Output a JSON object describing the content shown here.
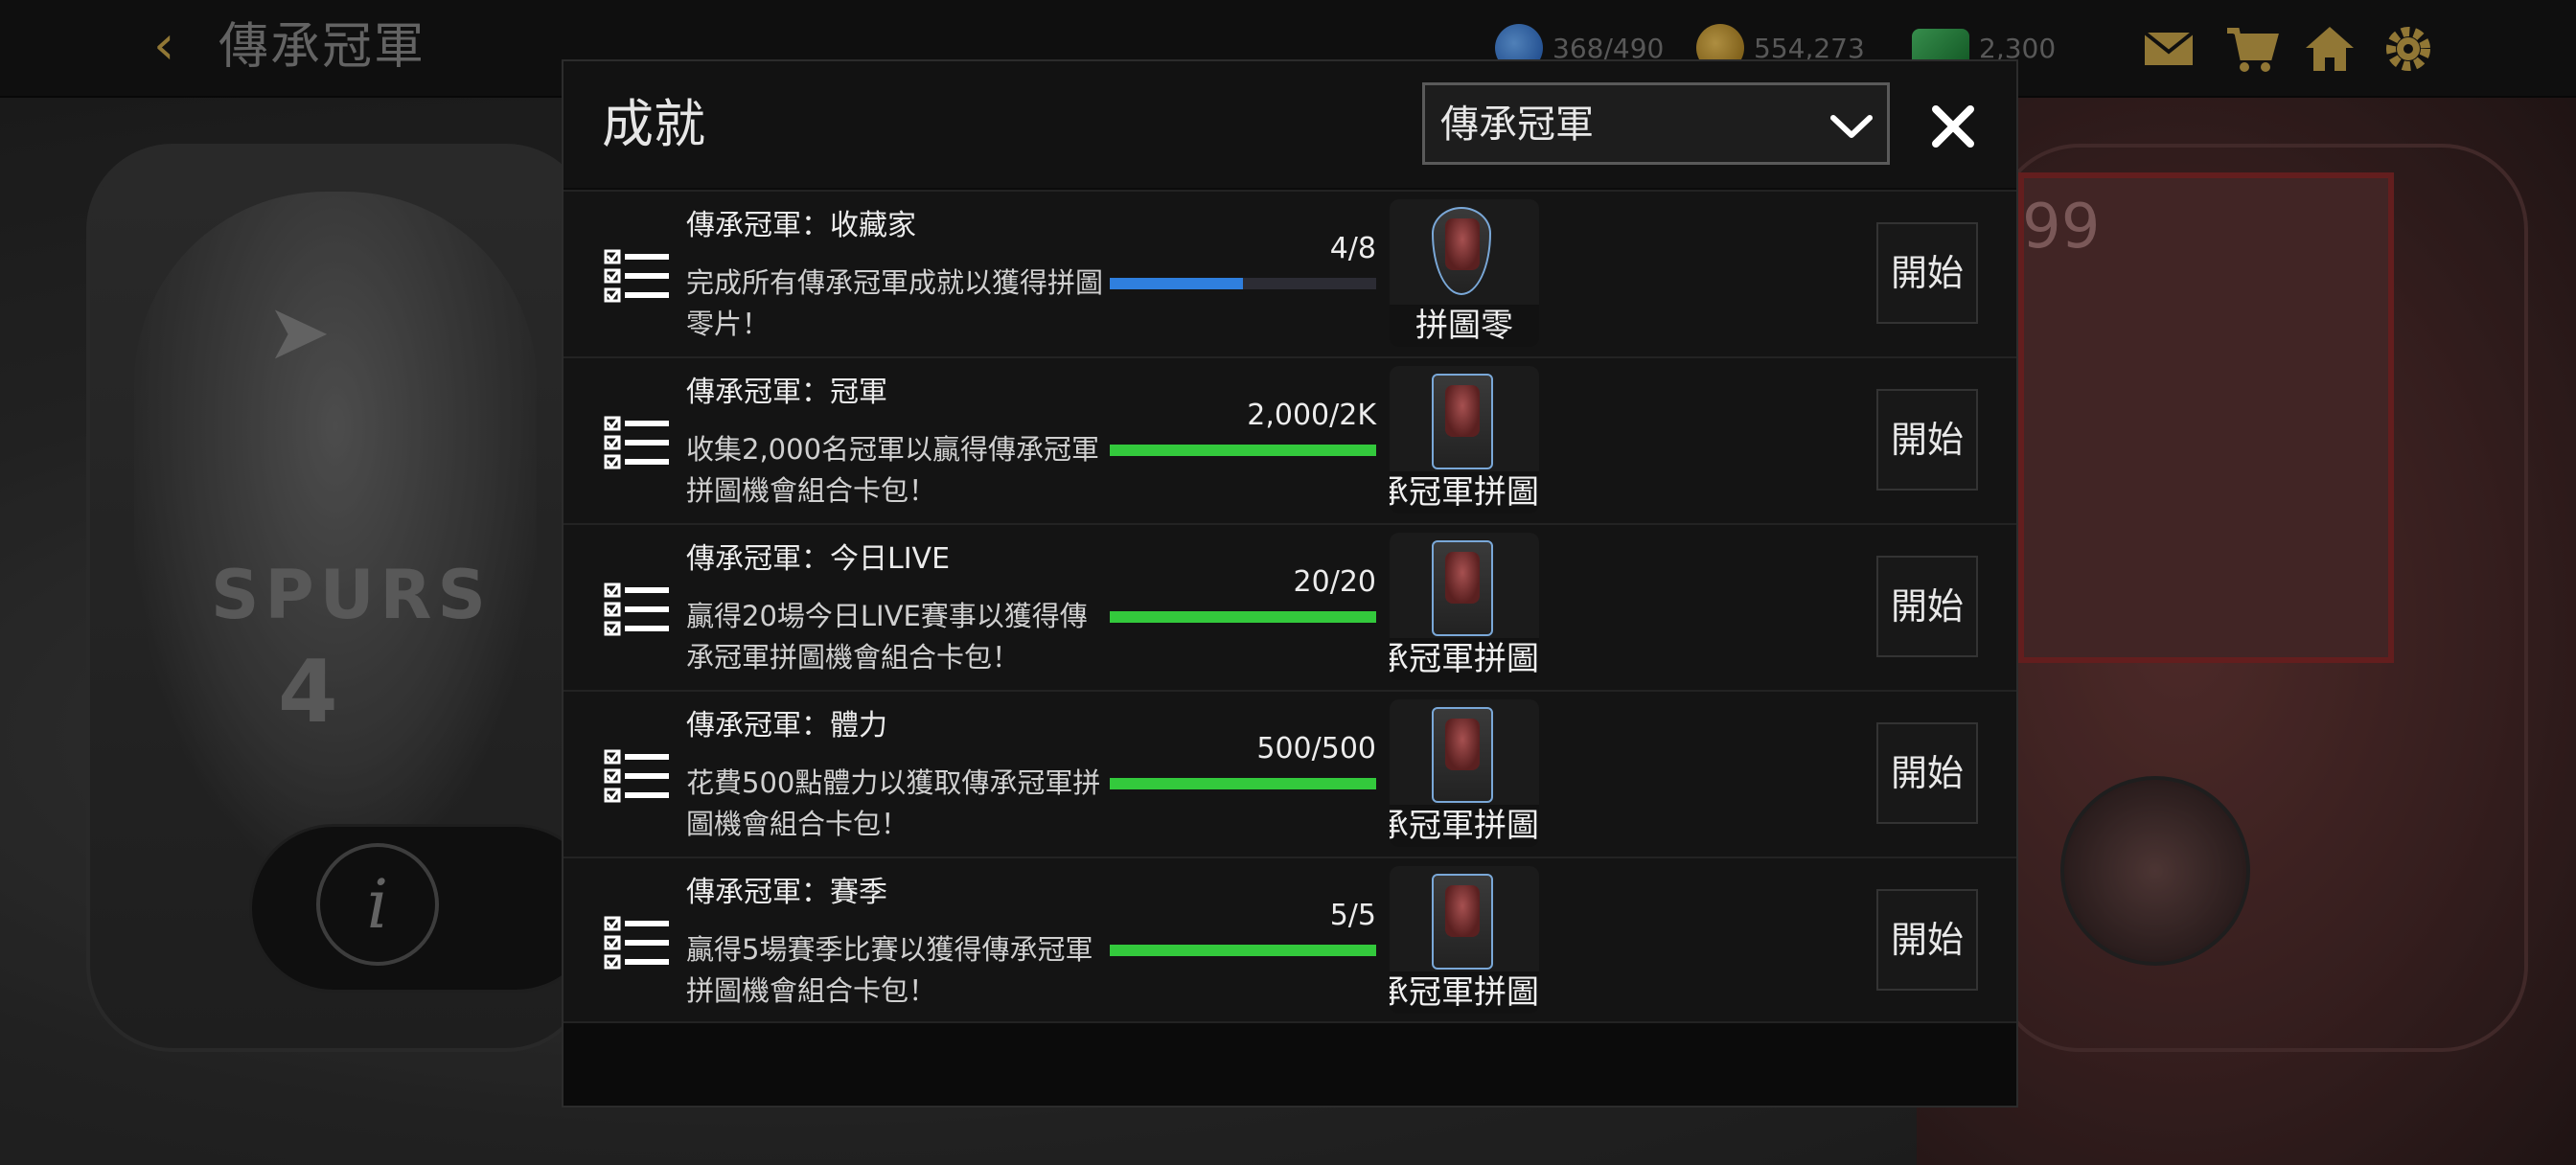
{
  "header": {
    "back_icon": "chevron-left-icon",
    "title": "傳承冠軍",
    "energy": "368/490",
    "gold": "554,273",
    "cash": "2,300",
    "icons": [
      "mail-icon",
      "cart-icon",
      "home-icon",
      "gear-icon"
    ]
  },
  "background": {
    "jersey_text": "SPURS",
    "jersey_number": "4",
    "puzzle_number": "99"
  },
  "modal": {
    "title": "成就",
    "dropdown_value": "傳承冠軍",
    "close_icon": "close-icon",
    "start_label": "開始",
    "rows": [
      {
        "title": "傳承冠軍：收藏家",
        "desc": "完成所有傳承冠軍成就以獲得拼圖零片！",
        "count": "4/8",
        "progress": 0.5,
        "bar_color": "#2f7fde",
        "reward_label": "拼圖零",
        "reward_type": "puzzle-piece"
      },
      {
        "title": "傳承冠軍：冠軍",
        "desc": "收集2,000名冠軍以贏得傳承冠軍拼圖機會組合卡包！",
        "count": "2,000/2K",
        "progress": 1.0,
        "bar_color": "#33c93c",
        "reward_label": "承冠軍拼圖",
        "reward_type": "card-pack"
      },
      {
        "title": "傳承冠軍：今日LIVE",
        "desc": "贏得20場今日LIVE賽事以獲得傳承冠軍拼圖機會組合卡包！",
        "count": "20/20",
        "progress": 1.0,
        "bar_color": "#33c93c",
        "reward_label": "承冠軍拼圖",
        "reward_type": "card-pack"
      },
      {
        "title": "傳承冠軍：體力",
        "desc": "花費500點體力以獲取傳承冠軍拼圖機會組合卡包！",
        "count": "500/500",
        "progress": 1.0,
        "bar_color": "#33c93c",
        "reward_label": "承冠軍拼圖",
        "reward_type": "card-pack"
      },
      {
        "title": "傳承冠軍：賽季",
        "desc": "贏得5場賽季比賽以獲得傳承冠軍拼圖機會組合卡包！",
        "count": "5/5",
        "progress": 1.0,
        "bar_color": "#33c93c",
        "reward_label": "承冠軍拼圖",
        "reward_type": "card-pack"
      }
    ]
  }
}
